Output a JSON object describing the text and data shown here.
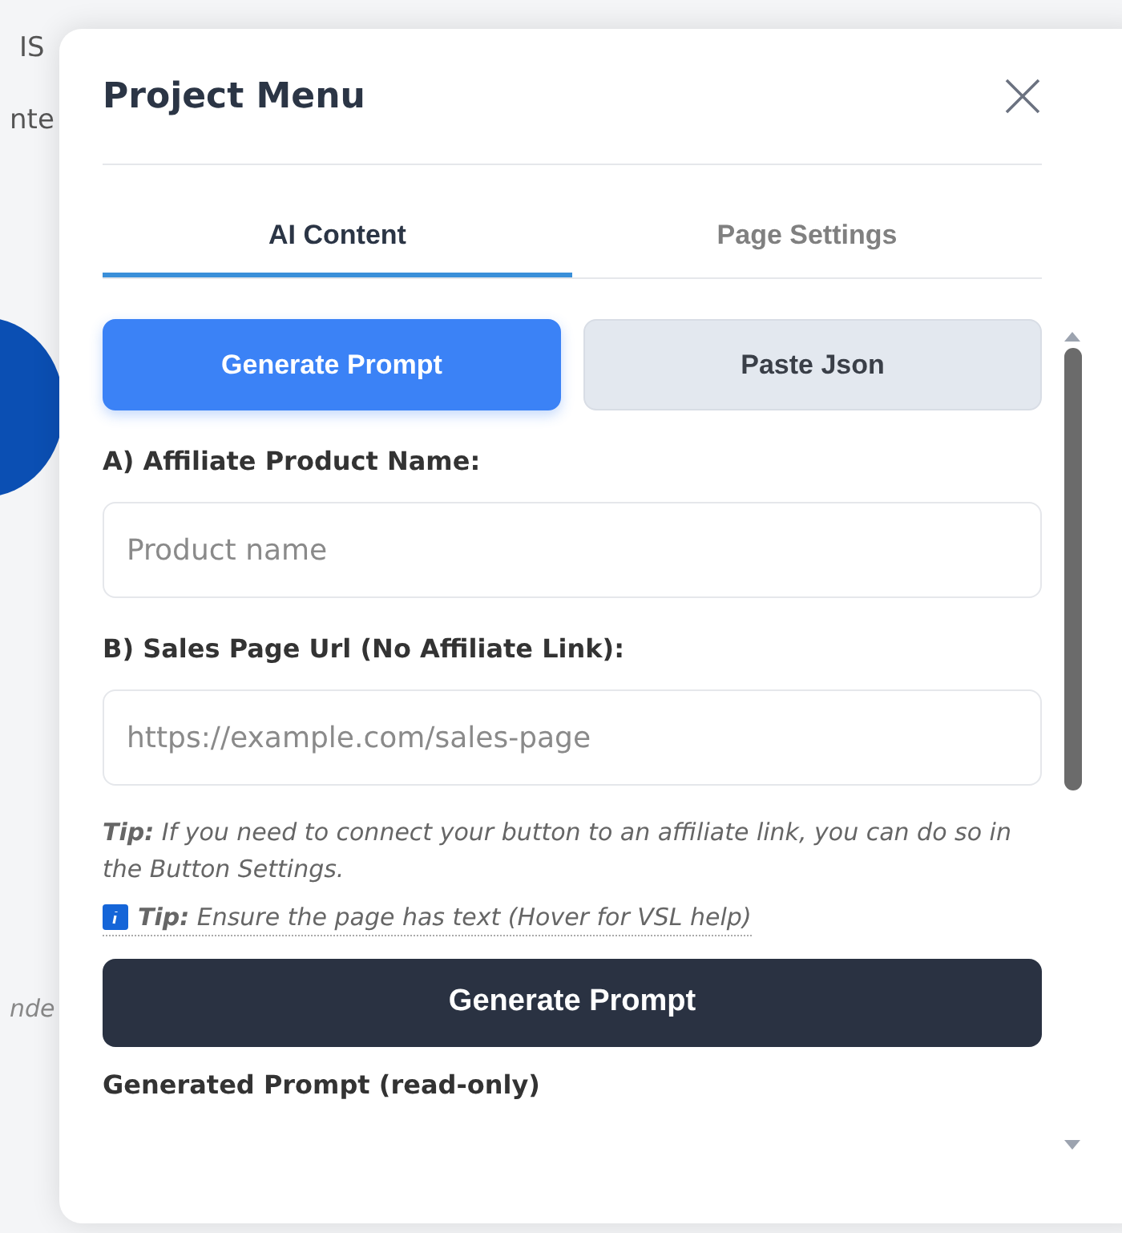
{
  "background": {
    "fragments": [
      "IS",
      "nte",
      "nde"
    ]
  },
  "dialog": {
    "title": "Project Menu",
    "tabs": [
      {
        "label": "AI Content",
        "selected": true
      },
      {
        "label": "Page Settings",
        "selected": false
      }
    ],
    "modes": [
      {
        "label": "Generate Prompt",
        "selected": true
      },
      {
        "label": "Paste Json",
        "selected": false
      }
    ],
    "fields": [
      {
        "label": "A) Affiliate Product Name:",
        "placeholder": "Product name"
      },
      {
        "label": "B) Sales Page Url (No Affiliate Link):",
        "placeholder": "https://example.com/sales-page"
      }
    ],
    "tip": "**Tip:** If you need to connect your button to an affiliate link, you can do so in the Button Settings.",
    "hover_tip": "**Tip:** Ensure the page has text (Hover for VSL help)",
    "generate_button": "Generate Prompt",
    "output_label": "Generated Prompt (read-only)"
  }
}
